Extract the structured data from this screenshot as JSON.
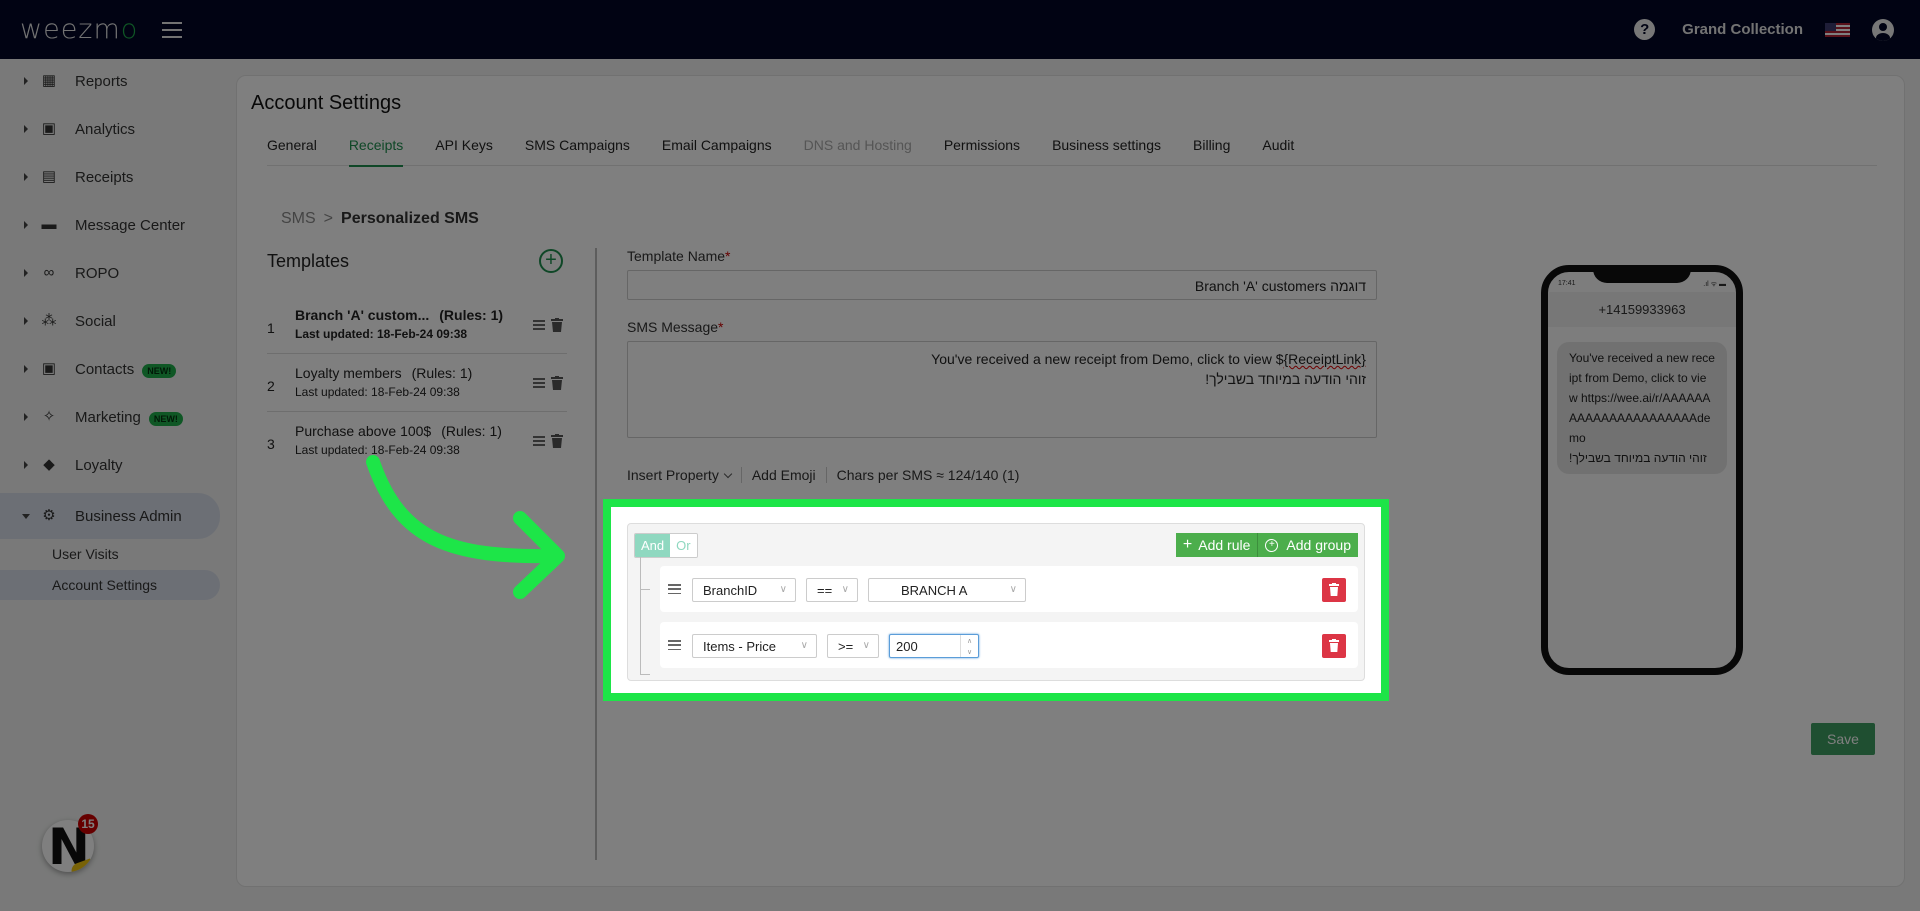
{
  "topbar": {
    "logo_text": "weezm",
    "logo_accent": "o",
    "account_name": "Grand Collection",
    "help_glyph": "?"
  },
  "sidebar": {
    "items": [
      {
        "label": "Reports",
        "icon": "dashboard-icon",
        "glyph": "▦"
      },
      {
        "label": "Analytics",
        "icon": "analytics-icon",
        "glyph": "▣"
      },
      {
        "label": "Receipts",
        "icon": "receipt-icon",
        "glyph": "▤"
      },
      {
        "label": "Message Center",
        "icon": "chat-icon",
        "glyph": "▬"
      },
      {
        "label": "ROPO",
        "icon": "infinity-icon",
        "glyph": "∞"
      },
      {
        "label": "Social",
        "icon": "people-icon",
        "glyph": "⁂"
      },
      {
        "label": "Contacts",
        "icon": "contacts-icon",
        "glyph": "▣",
        "badge": "NEW!"
      },
      {
        "label": "Marketing",
        "icon": "party-popper-icon",
        "glyph": "✧",
        "badge": "NEW!"
      },
      {
        "label": "Loyalty",
        "icon": "tag-icon",
        "glyph": "◆"
      },
      {
        "label": "Business Admin",
        "icon": "gear-icon",
        "glyph": "⚙"
      }
    ],
    "sub_items": [
      {
        "label": "User Visits"
      },
      {
        "label": "Account Settings"
      }
    ],
    "notification_count": "15",
    "fab_letter": "N"
  },
  "page": {
    "title": "Account Settings",
    "tabs": [
      {
        "label": "General"
      },
      {
        "label": "Receipts"
      },
      {
        "label": "API Keys"
      },
      {
        "label": "SMS Campaigns"
      },
      {
        "label": "Email Campaigns"
      },
      {
        "label": "DNS and Hosting"
      },
      {
        "label": "Permissions"
      },
      {
        "label": "Business settings"
      },
      {
        "label": "Billing"
      },
      {
        "label": "Audit"
      }
    ],
    "active_tab": "Receipts",
    "breadcrumb": {
      "parent": "SMS",
      "separator": ">",
      "current": "Personalized SMS"
    }
  },
  "templates": {
    "title": "Templates",
    "items": [
      {
        "num": "1",
        "name": "Branch 'A' custom...",
        "rules": "(Rules: 1)",
        "updated": "Last updated: 18-Feb-24 09:38"
      },
      {
        "num": "2",
        "name": "Loyalty members",
        "rules": "(Rules: 1)",
        "updated": "Last updated: 18-Feb-24 09:38"
      },
      {
        "num": "3",
        "name": "Purchase above 100$",
        "rules": "(Rules: 1)",
        "updated": "Last updated: 18-Feb-24 09:38"
      }
    ]
  },
  "form": {
    "template_name_label": "Template Name",
    "template_name_value": "דוגמה Branch 'A' customers",
    "sms_label": "SMS Message",
    "required_mark": "*",
    "sms_line1_prefix": "You've received a new receipt from Demo, click to view $",
    "sms_line1_token": "{ReceiptLink}",
    "sms_line2": "זוהי הודעה במיוחד בשבילך!",
    "insert_property": "Insert Property",
    "add_emoji": "Add Emoji",
    "chars_per_sms": "Chars per SMS ≈ 124/140 (1)",
    "save_label": "Save"
  },
  "rule_builder": {
    "and_label": "And",
    "or_label": "Or",
    "add_rule_label": "Add rule",
    "add_group_label": "Add group",
    "rules": [
      {
        "field": "BranchID",
        "operator": "==",
        "value": "BRANCH A"
      },
      {
        "field": "Items - Price",
        "operator": ">=",
        "value": "200"
      }
    ]
  },
  "phone_preview": {
    "time": "17:41",
    "status": ".ıl ᯤ ▬",
    "sender": "+14159933963",
    "message": "You've received a new receipt from Demo, click to view https://wee.ai/r/AAAAAAAAAAAAAAAAAAAAAAdemo",
    "message_rtl": "זוהי הודעה במיוחד בשבילך!"
  },
  "colors": {
    "topbar_bg": "#020726",
    "accent_green": "#1e8f4e",
    "highlight_green": "#1de548",
    "danger_red": "#dc3545",
    "rule_btn_green": "#4cae4c"
  }
}
